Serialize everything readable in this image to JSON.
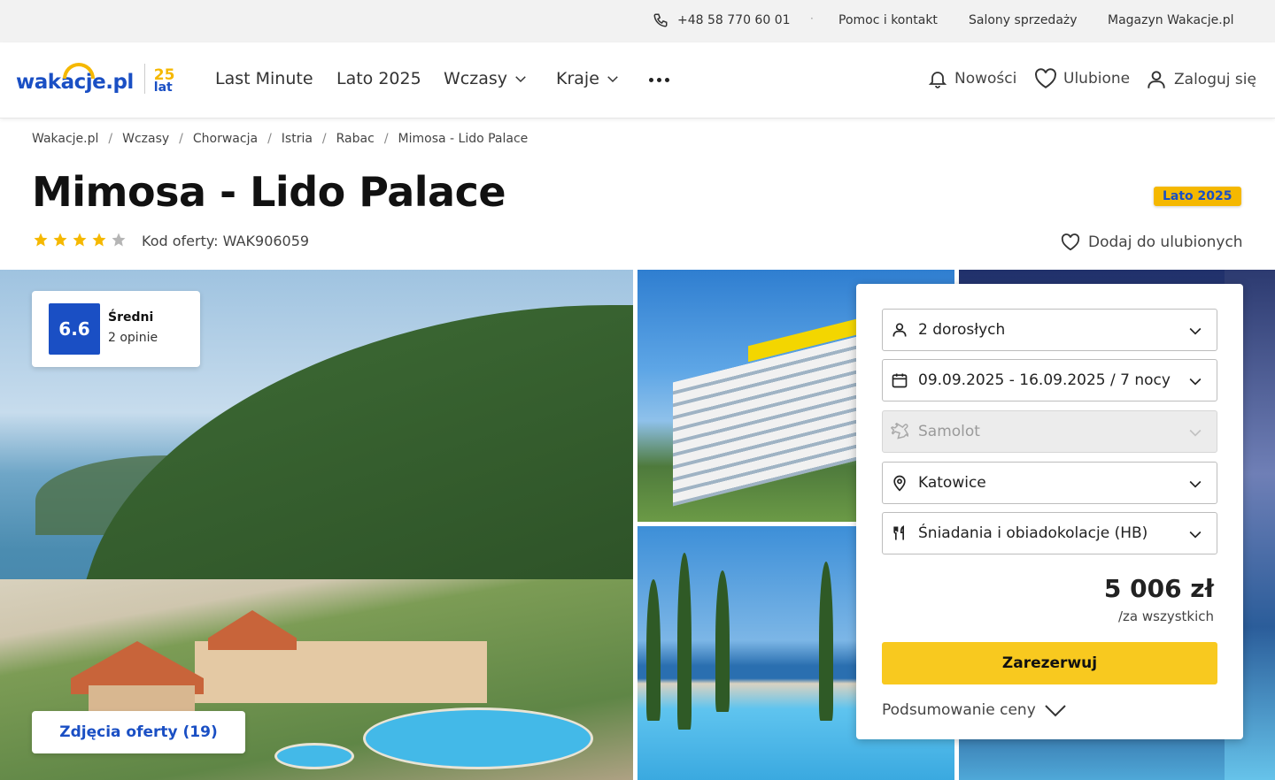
{
  "topbar": {
    "phone": "+48 58 770 60 01",
    "separator": "·",
    "links": [
      "Pomoc i kontakt",
      "Salony sprzedaży",
      "Magazyn Wakacje.pl"
    ]
  },
  "header": {
    "logo": {
      "wordmark": "wakacje.pl",
      "years_number": "25",
      "years_label": "lat"
    },
    "nav": [
      "Last Minute",
      "Lato 2025",
      "Wczasy",
      "Kraje"
    ],
    "right": {
      "news": "Nowości",
      "favorites": "Ulubione",
      "login": "Zaloguj się"
    }
  },
  "breadcrumb": [
    "Wakacje.pl",
    "Wczasy",
    "Chorwacja",
    "Istria",
    "Rabac",
    "Mimosa - Lido Palace"
  ],
  "hotel": {
    "title": "Mimosa - Lido Palace",
    "season_badge": "Lato 2025",
    "stars": 4,
    "stars_max": 5,
    "offer_code": "Kod oferty: WAK906059",
    "add_favorite": "Dodaj do ulubionych"
  },
  "rating": {
    "score": "6.6",
    "label": "Średni",
    "count": "2 opinie"
  },
  "gallery": {
    "button": "Zdjęcia oferty (19)"
  },
  "booking": {
    "guests": "2 dorosłych",
    "dates": "09.09.2025 - 16.09.2025 / 7 nocy",
    "transport": "Samolot",
    "departure": "Katowice",
    "board": "Śniadania i obiadokolacje (HB)",
    "price": "5 006 zł",
    "price_note": "/za wszystkich",
    "reserve_label": "Zarezerwuj",
    "summary_label": "Podsumowanie ceny"
  },
  "colors": {
    "brand_blue": "#1a4fc4",
    "accent_yellow": "#f8c91f",
    "star": "#f5b800"
  }
}
